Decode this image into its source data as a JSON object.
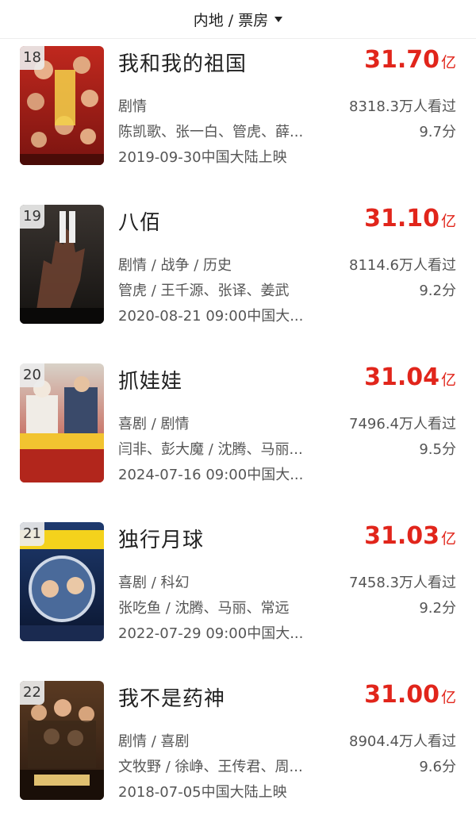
{
  "header": {
    "filter_label": "内地 / 票房",
    "caret_icon": "caret-down-icon"
  },
  "movies": [
    {
      "rank": "18",
      "title": "我和我的祖国",
      "gross_value": "31.70",
      "gross_unit": "亿",
      "genre": "剧情",
      "cast": "陈凯歌、张一白、管虎、薛...",
      "release": "2019-09-30中国大陆上映",
      "viewers": "8318.3万人看过",
      "score": "9.7分",
      "poster_colors": [
        "#c0281e",
        "#7a1410"
      ]
    },
    {
      "rank": "19",
      "title": "八佰",
      "gross_value": "31.10",
      "gross_unit": "亿",
      "genre": "剧情 / 战争 / 历史",
      "cast": "管虎 / 王千源、张译、姜武",
      "release": "2020-08-21 09:00中国大...",
      "viewers": "8114.6万人看过",
      "score": "9.2分",
      "poster_colors": [
        "#3a3430",
        "#141210"
      ]
    },
    {
      "rank": "20",
      "title": "抓娃娃",
      "gross_value": "31.04",
      "gross_unit": "亿",
      "genre": "喜剧 / 剧情",
      "cast": "闫非、彭大魔 / 沈腾、马丽...",
      "release": "2024-07-16 09:00中国大...",
      "viewers": "7496.4万人看过",
      "score": "9.5分",
      "poster_colors": [
        "#d8d2c8",
        "#c0392b"
      ]
    },
    {
      "rank": "21",
      "title": "独行月球",
      "gross_value": "31.03",
      "gross_unit": "亿",
      "genre": "喜剧 / 科幻",
      "cast": "张吃鱼 / 沈腾、马丽、常远",
      "release": "2022-07-29 09:00中国大...",
      "viewers": "7458.3万人看过",
      "score": "9.2分",
      "poster_colors": [
        "#1e3a6e",
        "#0b1630"
      ]
    },
    {
      "rank": "22",
      "title": "我不是药神",
      "gross_value": "31.00",
      "gross_unit": "亿",
      "genre": "剧情 / 喜剧",
      "cast": "文牧野 / 徐峥、王传君、周...",
      "release": "2018-07-05中国大陆上映",
      "viewers": "8904.4万人看过",
      "score": "9.6分",
      "poster_colors": [
        "#5a3a22",
        "#2a1a10"
      ]
    }
  ]
}
